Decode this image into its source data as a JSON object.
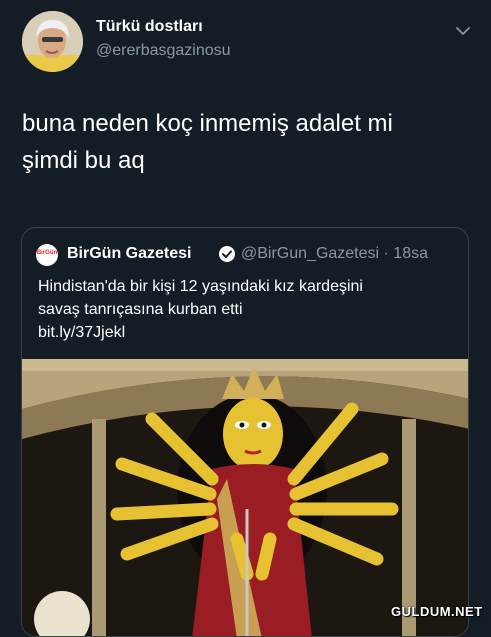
{
  "tweet": {
    "author": {
      "name": "Türkü dostları",
      "handle": "@ererbasgazinosu",
      "avatar_icon": "user-avatar-photo"
    },
    "menu_icon": "chevron-down-icon",
    "text_lines": [
      "buna neden koç inmemiş adalet mi",
      "şimdi bu aq"
    ]
  },
  "quote": {
    "logo_text": "BirGün",
    "name": "BirGün Gazetesi",
    "verified_icon": "verified-badge-icon",
    "handle_time": "@BirGun_Gazetesi · 18sa",
    "text_lines": [
      "Hindistan'da bir kişi 12 yaşındaki kız kardeşini",
      "savaş tanrıçasına kurban etti",
      "bit.ly/37Jjekl"
    ]
  },
  "watermark": "GULDUM.NET",
  "colors": {
    "background": "#141d26",
    "secondary_text": "#8899a6",
    "border": "#38444d",
    "verified_badge": "#ffffff"
  }
}
